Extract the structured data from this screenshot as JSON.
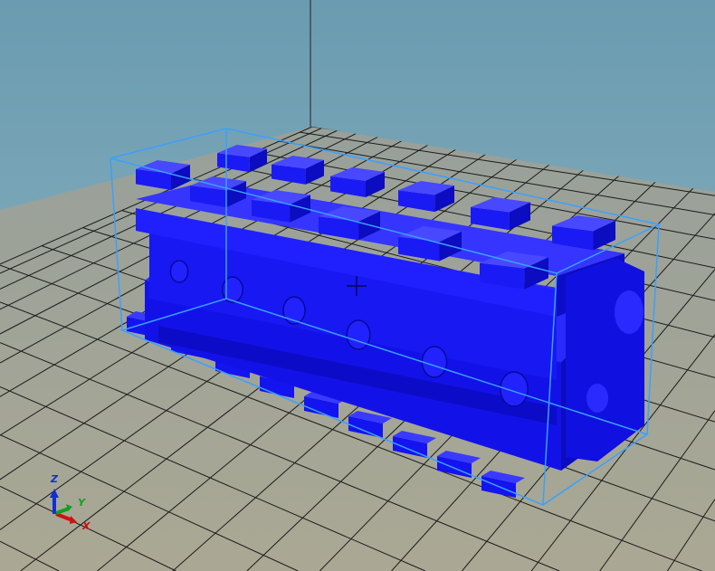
{
  "viewport": {
    "colors": {
      "sky_top": "#6a9bb0",
      "sky_bottom": "#8fb5c0",
      "floor": "#a3a496",
      "grid": "#1a1a1a",
      "model": "#1414f0",
      "model_dark": "#0a0ab0",
      "model_light": "#4a4aff",
      "bbox": "#3aa0ff"
    },
    "model_name_icon": "engine-block-model",
    "triad": {
      "z_label": "Z",
      "y_label": "Y",
      "x_label": "X",
      "z_color": "#1030d0",
      "y_color": "#10a020",
      "x_color": "#d01010"
    }
  }
}
